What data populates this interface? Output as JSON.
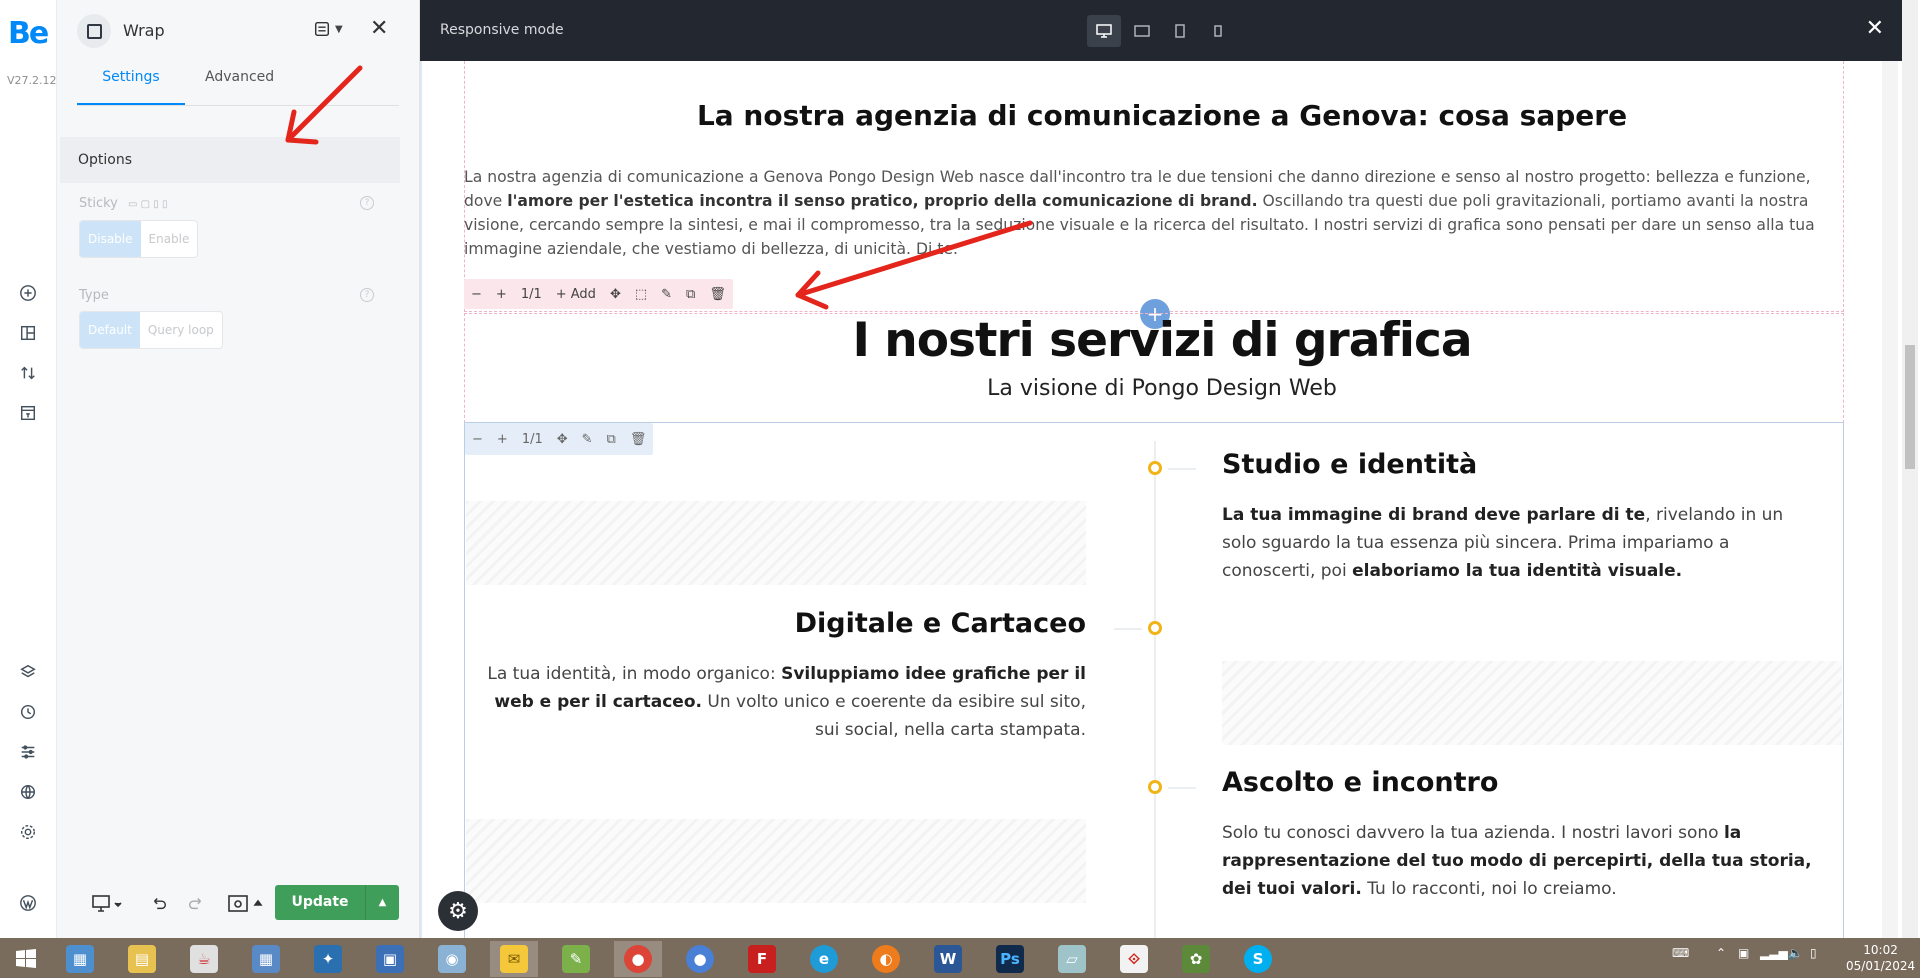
{
  "rail": {
    "logo": "Be",
    "version": "V27.2.12",
    "icons": [
      "add-icon",
      "layout-icon",
      "sort-icon",
      "template-icon",
      "layers-icon",
      "history-icon",
      "sliders-icon",
      "globe-icon",
      "settings-icon",
      "wordpress-icon"
    ]
  },
  "panel": {
    "title": "Wrap",
    "tabs": [
      "Settings",
      "Advanced"
    ],
    "section": "Options",
    "sticky": {
      "label": "Sticky",
      "options": [
        "Disable",
        "Enable"
      ],
      "selected": "Disable"
    },
    "type": {
      "label": "Type",
      "options": [
        "Default",
        "Query loop"
      ],
      "selected": "Default"
    },
    "update_label": "Update"
  },
  "topbar": {
    "mode_label": "Responsive mode",
    "devices": [
      "desktop-icon",
      "laptop-icon",
      "tablet-icon",
      "mobile-icon"
    ],
    "active_device": "desktop-icon"
  },
  "canvas": {
    "section_title": "La nostra agenzia di comunicazione a Genova: cosa sapere",
    "para": {
      "p1": "La nostra agenzia di comunicazione a Genova Pongo Design Web nasce dall'incontro tra le due tensioni che danno direzione e senso al nostro progetto: bellezza e funzione, dove ",
      "b1": "l'amore per l'estetica incontra il senso pratico, proprio della comunicazione di brand.",
      "p2": " Oscillando tra questi due poli gravitazionali, portiamo avanti la nostra visione, cercando sempre la sintesi, e mai il compromesso, tra la seduzione visuale e la ricerca del risultato. I nostri servizi di grafica sono pensati per dare un senso alla tua immagine aziendale, che vestiamo di bellezza, di unicità. Di te."
    },
    "toolbar1": {
      "size": "1/1",
      "add": "Add"
    },
    "toolbar2": {
      "size": "1/1"
    },
    "heading": "I nostri servizi di grafica",
    "subheading": "La visione di Pongo Design Web",
    "timeline": [
      {
        "title": "Studio e identità",
        "bold1": "La tua immagine di brand deve parlare di te",
        "text1": ", rivelando in un solo sguardo la tua essenza più sincera. Prima impariamo a conoscerti, poi ",
        "bold2": "elaboriamo la tua identità visuale."
      },
      {
        "title": "Digitale e Cartaceo",
        "text1": "La tua identità, in modo organico: ",
        "bold1": "Sviluppiamo idee grafiche per il web e per il cartaceo.",
        "text2": " Un volto unico e coerente da esibire sul sito, sui social, nella carta stampata."
      },
      {
        "title": "Ascolto e incontro",
        "text1": "Solo tu conosci davvero la tua azienda. I nostri lavori sono ",
        "bold1": "la rappresentazione del tuo modo di percepirti, della tua storia, dei tuoi valori.",
        "text2": " Tu lo racconti, noi lo creiamo."
      }
    ]
  },
  "taskbar": {
    "apps": [
      "windows-start",
      "explorer",
      "files",
      "java",
      "calculator",
      "butterfly",
      "network",
      "globe-app",
      "sticky-notes",
      "notepad",
      "chrome",
      "chromium",
      "filezilla",
      "edge",
      "firefox",
      "word",
      "photoshop",
      "notes",
      "acrobat",
      "gimp",
      "skype"
    ],
    "time": "10:02",
    "date": "05/01/2024"
  }
}
